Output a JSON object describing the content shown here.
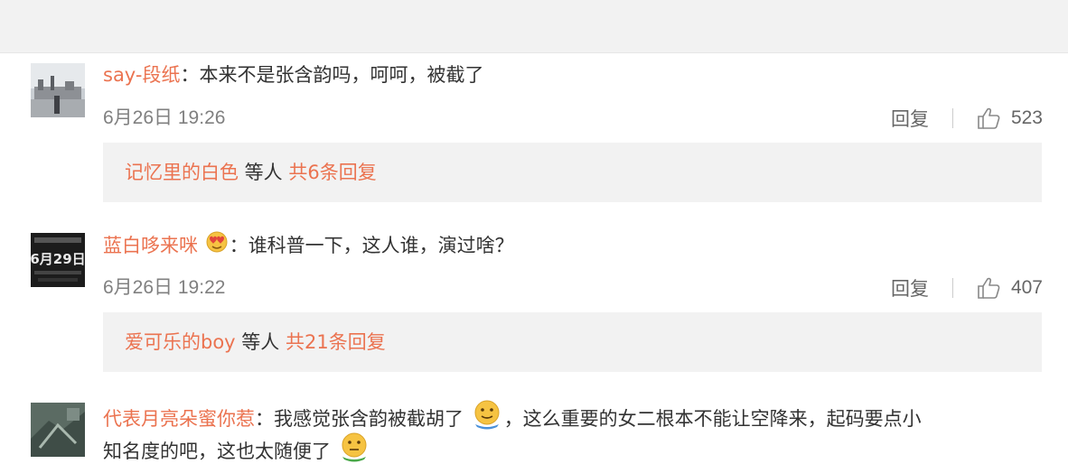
{
  "comments": [
    {
      "username": "say-段纸",
      "separator": "：",
      "text": "本来不是张含韵吗，呵呵，被截了",
      "timestamp": "6月26日 19:26",
      "reply_label": "回复",
      "likes": "523",
      "replies_preview": {
        "user": "记忆里的白色",
        "middle": " 等人 ",
        "count_text": "共6条回复"
      }
    },
    {
      "username": "蓝白哆来咪",
      "separator": "：",
      "text": "谁科普一下，这人谁，演过啥？",
      "timestamp": "6月26日 19:22",
      "reply_label": "回复",
      "likes": "407",
      "replies_preview": {
        "user": "爱可乐的boy",
        "middle": " 等人 ",
        "count_text": "共21条回复"
      }
    },
    {
      "username": "代表月亮朵蜜你惹",
      "separator": "：",
      "text_part1": "我感觉张含韵被截胡了",
      "text_part2": "，这么重要的女二根本不能让空降来，起码要点小",
      "text_line2": "知名度的吧，这也太随便了"
    }
  ],
  "avatar_overlay_text": "6月29日",
  "icons": {
    "like": "thumbs-up-icon",
    "emoji_smile": "smile-emoji-icon",
    "emoji_heart_eyes": "heart-eyes-emoji-icon"
  },
  "colors": {
    "username": "#eb7350",
    "text": "#333333",
    "meta": "#808080",
    "reply_box_bg": "#f2f2f2"
  }
}
